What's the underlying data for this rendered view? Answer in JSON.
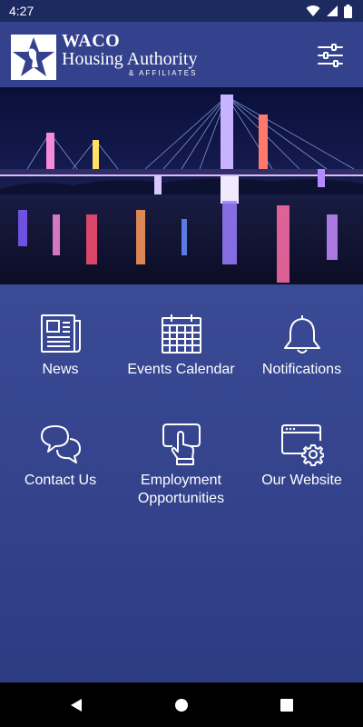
{
  "status_bar": {
    "time": "4:27"
  },
  "header": {
    "logo": {
      "line1": "WACO",
      "line2": "Housing Authority",
      "line3": "& AFFILIATES"
    },
    "menu_icon": "sliders-icon"
  },
  "hero": {
    "image": "illuminated-bridge-night-photo"
  },
  "tiles": [
    {
      "label": "News",
      "icon": "newspaper-icon"
    },
    {
      "label": "Events Calendar",
      "icon": "calendar-icon"
    },
    {
      "label": "Notifications",
      "icon": "bell-icon"
    },
    {
      "label": "Contact Us",
      "icon": "chat-bubbles-icon"
    },
    {
      "label_line1": "Employment",
      "label_line2": "Opportunities",
      "icon": "touch-screen-icon"
    },
    {
      "label": "Our Website",
      "icon": "browser-gear-icon"
    }
  ],
  "colors": {
    "header_bg": "#34418c",
    "main_bg": "#34438c",
    "status_bg": "#1d2a60"
  }
}
